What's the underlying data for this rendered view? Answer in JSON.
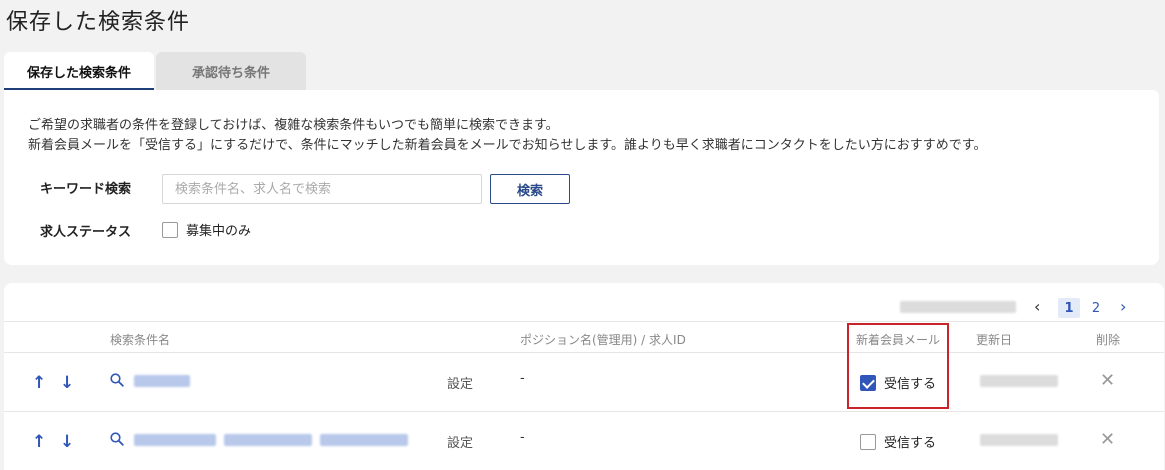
{
  "page": {
    "title": "保存した検索条件"
  },
  "tabs": [
    {
      "label": "保存した検索条件",
      "active": true
    },
    {
      "label": "承認待ち条件",
      "active": false
    }
  ],
  "description": {
    "line1": "ご希望の求職者の条件を登録しておけば、複雑な検索条件もいつでも簡単に検索できます。",
    "line2": "新着会員メールを「受信する」にするだけで、条件にマッチした新着会員をメールでお知らせします。誰よりも早く求職者にコンタクトをしたい方におすすめです。"
  },
  "search": {
    "keyword_label": "キーワード検索",
    "placeholder": "検索条件名、求人名で検索",
    "button": "検索",
    "status_label": "求人ステータス",
    "recruiting_only": "募集中のみ",
    "recruiting_only_checked": false
  },
  "pagination": {
    "prev": "‹",
    "pages": [
      "1",
      "2"
    ],
    "current": "1",
    "next": "›"
  },
  "table": {
    "headers": {
      "name": "検索条件名",
      "position": "ポジション名(管理用) / 求人ID",
      "mail": "新着会員メール",
      "updated": "更新日",
      "delete": "削除"
    },
    "rows": [
      {
        "settings": "設定",
        "position": "-",
        "mail_label": "受信する",
        "mail_checked": true
      },
      {
        "settings": "設定",
        "position": "-",
        "mail_label": "受信する",
        "mail_checked": false
      }
    ]
  },
  "icons": {
    "up": "↑",
    "down": "↓",
    "delete": "✕"
  },
  "colors": {
    "accent": "#2f56b8",
    "navy": "#1f3f7a",
    "highlight": "#c8242b"
  }
}
